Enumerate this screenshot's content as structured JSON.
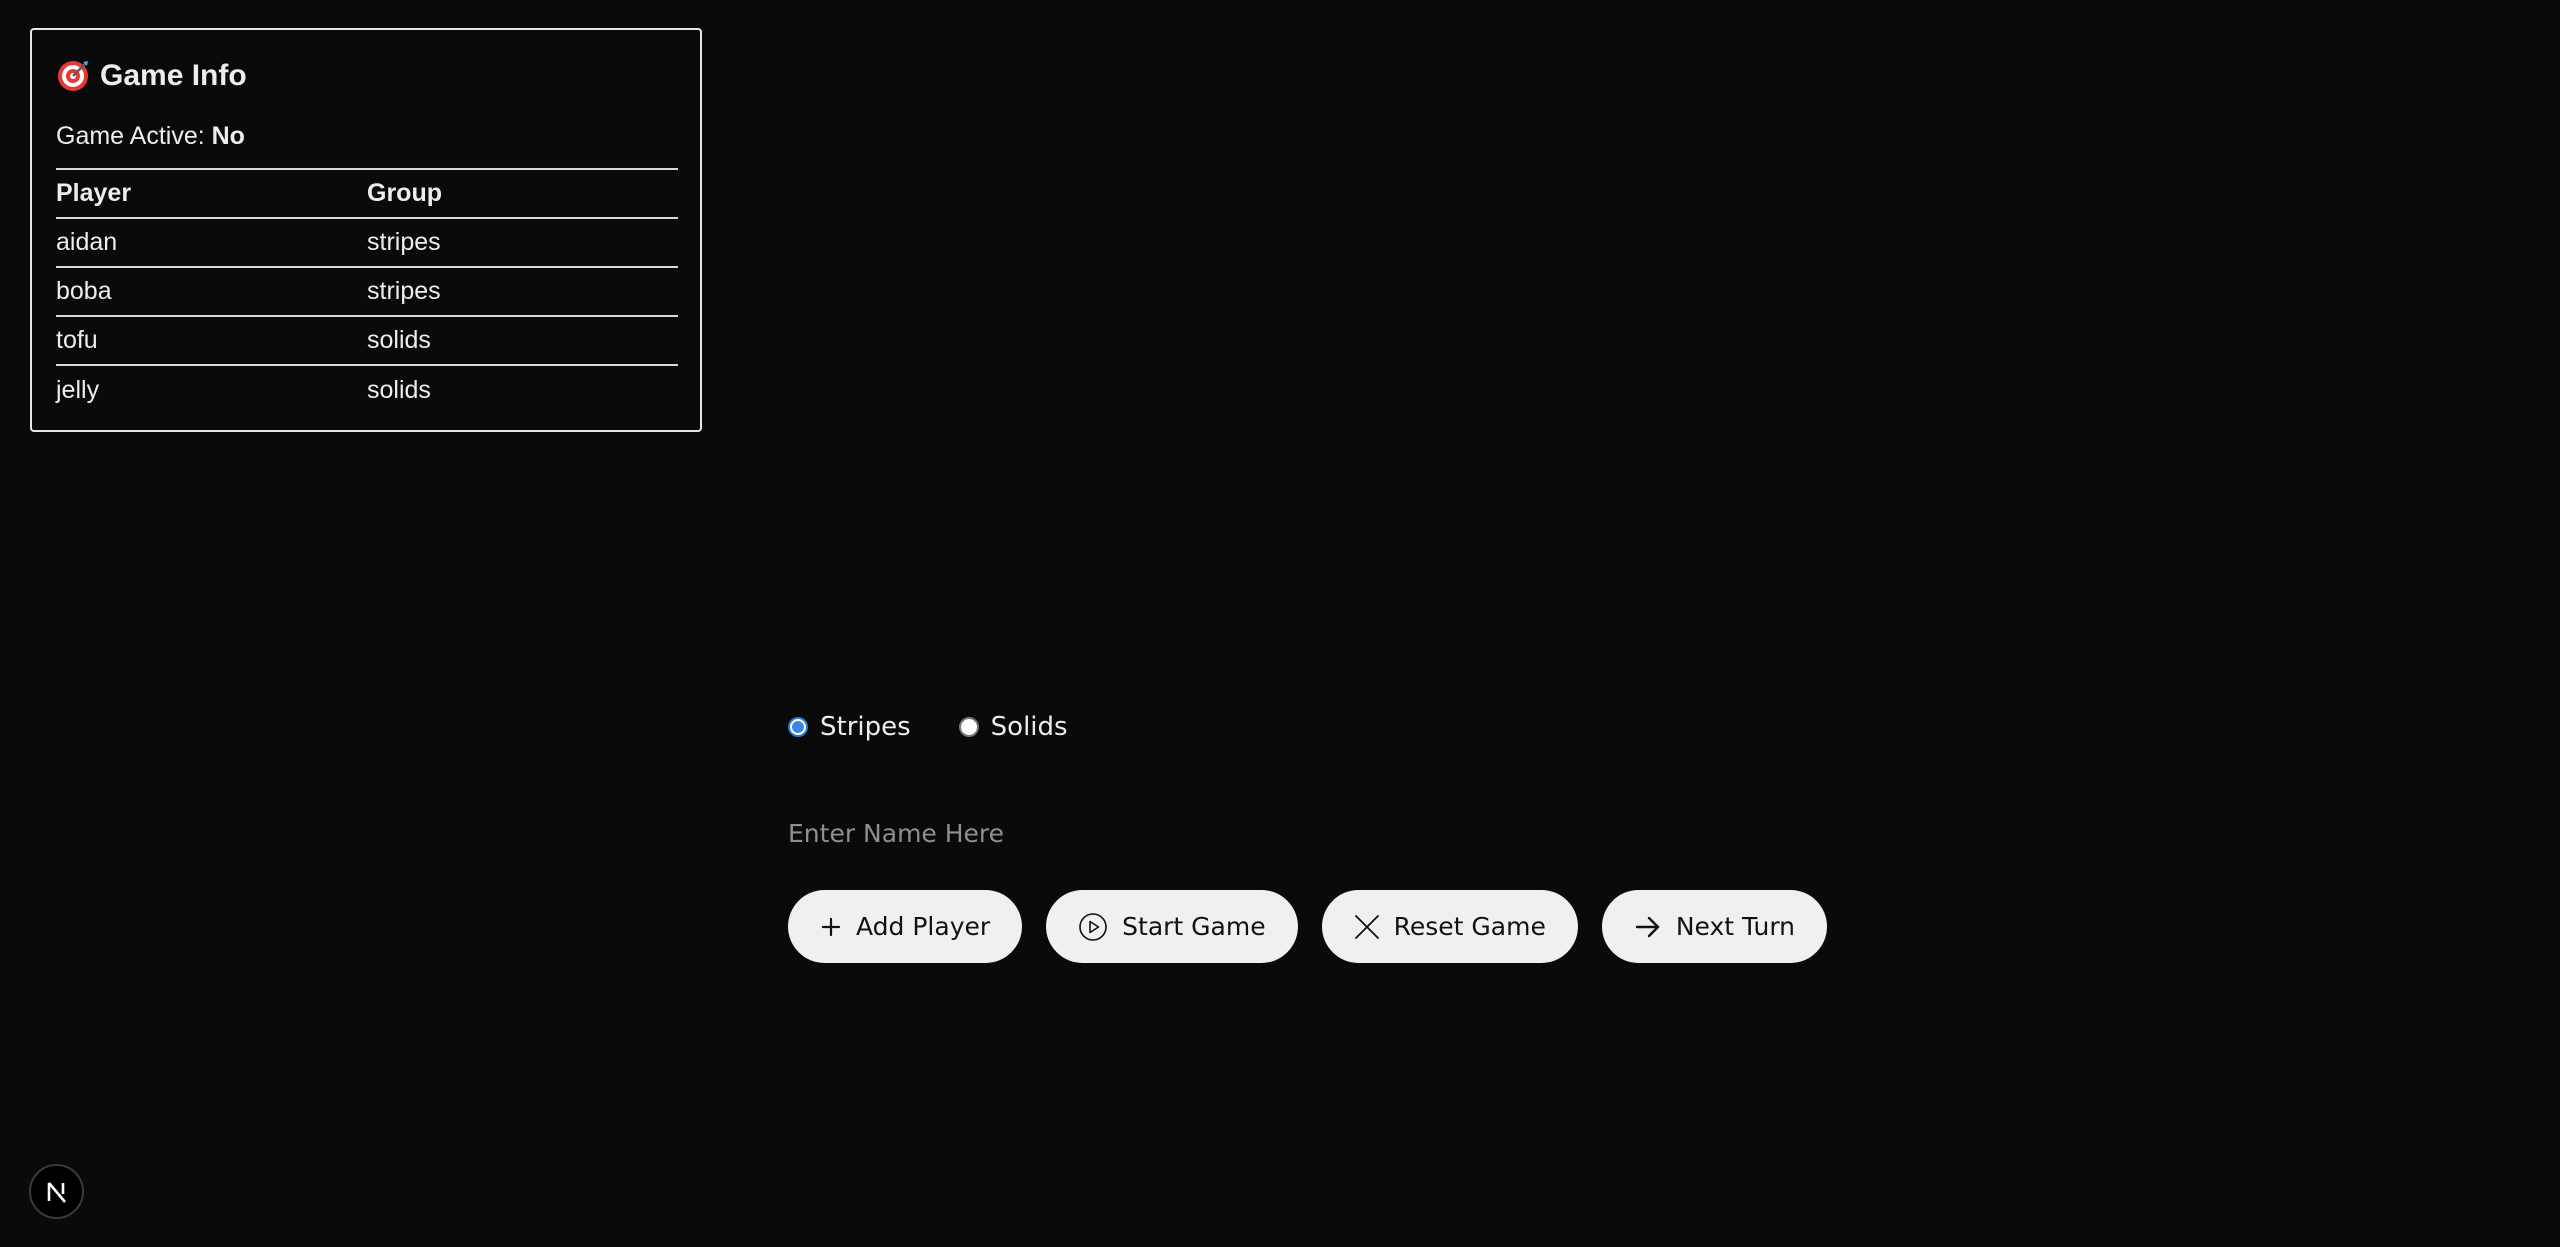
{
  "info": {
    "title": "Game Info",
    "active_label": "Game Active:",
    "active_value": "No",
    "headers": {
      "player": "Player",
      "group": "Group"
    },
    "rows": [
      {
        "player": "aidan",
        "group": "stripes"
      },
      {
        "player": "boba",
        "group": "stripes"
      },
      {
        "player": "tofu",
        "group": "solids"
      },
      {
        "player": "jelly",
        "group": "solids"
      }
    ]
  },
  "group_options": [
    {
      "label": "Stripes",
      "selected": true
    },
    {
      "label": "Solids",
      "selected": false
    }
  ],
  "name_input": {
    "placeholder": "Enter Name Here",
    "value": ""
  },
  "buttons": {
    "add": "Add Player",
    "start": "Start Game",
    "reset": "Reset Game",
    "next": "Next Turn"
  },
  "icons": {
    "title": "target-icon",
    "add": "plus-icon",
    "start": "play-circle-icon",
    "reset": "close-icon",
    "next": "arrow-right-icon",
    "badge": "nextjs-logo-icon"
  },
  "colors": {
    "background": "#0a0a0a",
    "button_bg": "#f0f0f0",
    "radio_accent": "#3b87e6"
  }
}
